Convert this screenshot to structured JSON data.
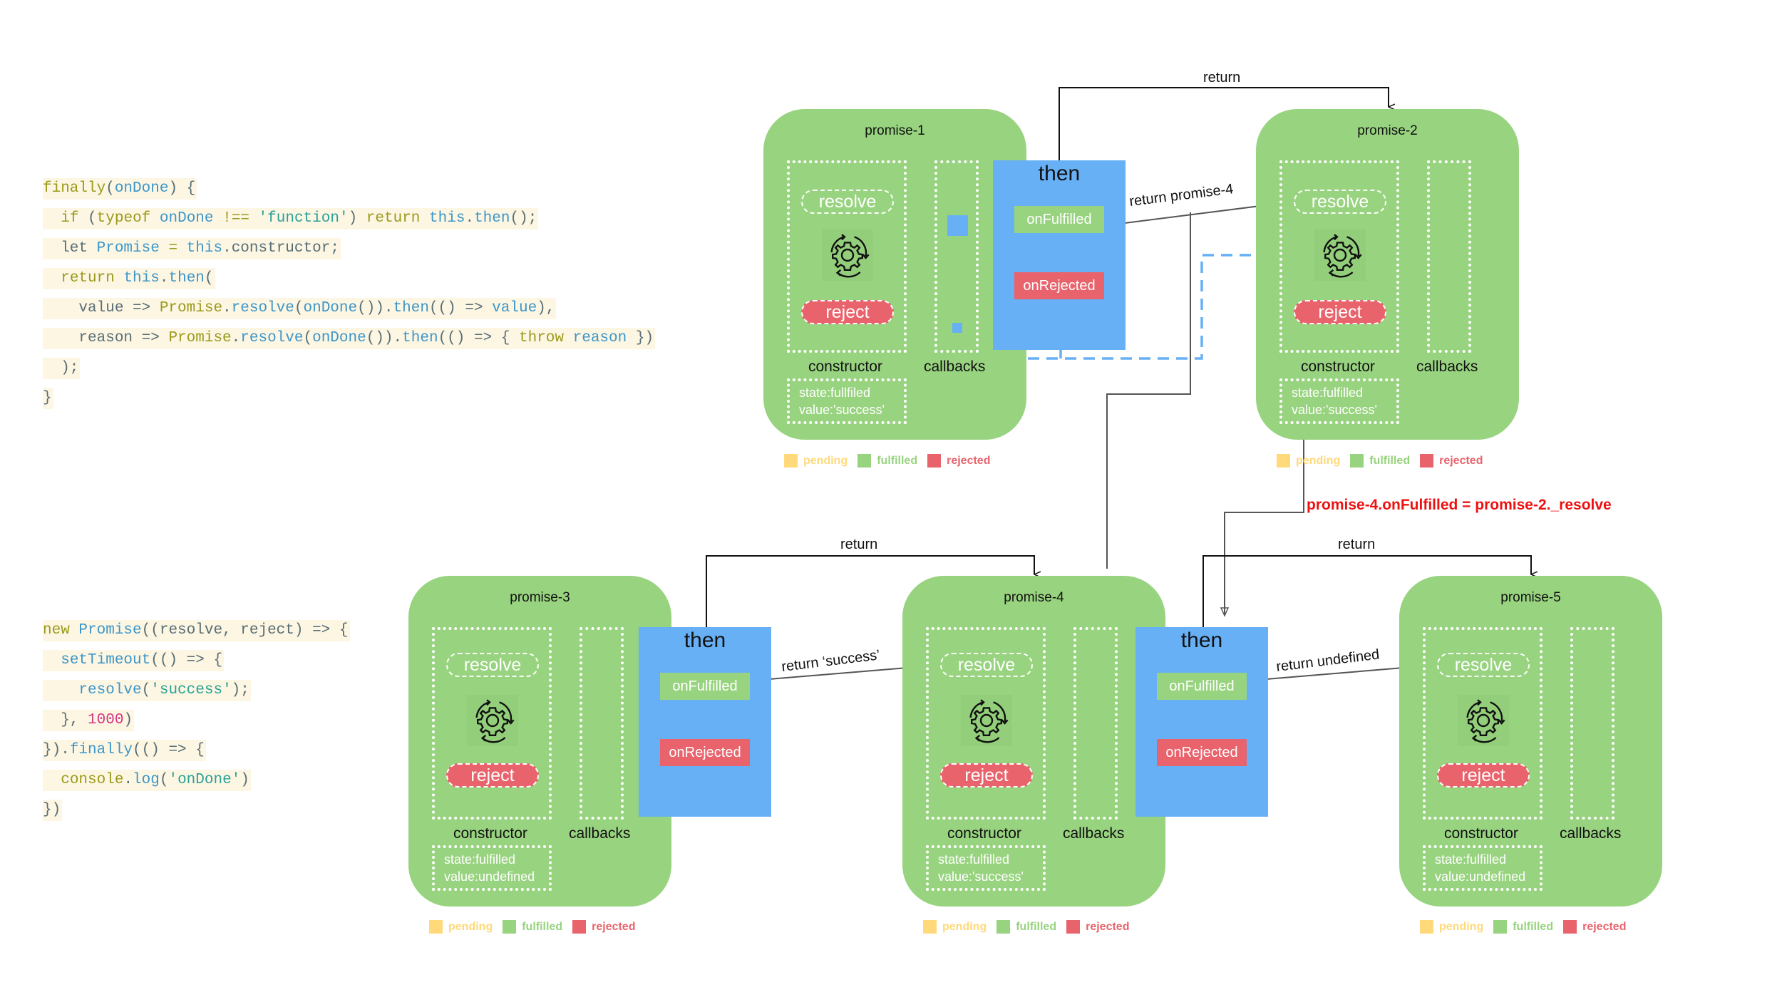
{
  "code_finally": {
    "lines": [
      [
        [
          "kw",
          "finally"
        ],
        [
          "plain",
          "("
        ],
        [
          "id",
          "onDone"
        ],
        [
          "plain",
          ") {"
        ]
      ],
      [
        [
          "plain",
          "  "
        ],
        [
          "kw",
          "if"
        ],
        [
          "plain",
          " ("
        ],
        [
          "kw",
          "typeof"
        ],
        [
          "plain",
          " "
        ],
        [
          "id",
          "onDone"
        ],
        [
          "plain",
          " "
        ],
        [
          "kw",
          "!=="
        ],
        [
          "plain",
          " "
        ],
        [
          "str",
          "'function'"
        ],
        [
          "plain",
          ") "
        ],
        [
          "kw",
          "return"
        ],
        [
          "plain",
          " "
        ],
        [
          "id",
          "this"
        ],
        [
          "plain",
          "."
        ],
        [
          "id",
          "then"
        ],
        [
          "plain",
          "();"
        ]
      ],
      [
        [
          "plain",
          "  let "
        ],
        [
          "id",
          "Promise"
        ],
        [
          "plain",
          " "
        ],
        [
          "kw",
          "="
        ],
        [
          "plain",
          " "
        ],
        [
          "id",
          "this"
        ],
        [
          "plain",
          ".constructor;"
        ]
      ],
      [
        [
          "plain",
          "  "
        ],
        [
          "kw",
          "return"
        ],
        [
          "plain",
          " "
        ],
        [
          "id",
          "this"
        ],
        [
          "plain",
          "."
        ],
        [
          "id",
          "then"
        ],
        [
          "plain",
          "("
        ]
      ],
      [
        [
          "plain",
          "    value => "
        ],
        [
          "kw",
          "Promise"
        ],
        [
          "plain",
          "."
        ],
        [
          "id",
          "resolve"
        ],
        [
          "plain",
          "("
        ],
        [
          "id",
          "onDone"
        ],
        [
          "plain",
          "())."
        ],
        [
          "id",
          "then"
        ],
        [
          "plain",
          "(() => "
        ],
        [
          "id",
          "value"
        ],
        [
          "plain",
          "),"
        ]
      ],
      [
        [
          "plain",
          "    reason => "
        ],
        [
          "kw",
          "Promise"
        ],
        [
          "plain",
          "."
        ],
        [
          "id",
          "resolve"
        ],
        [
          "plain",
          "("
        ],
        [
          "id",
          "onDone"
        ],
        [
          "plain",
          "())."
        ],
        [
          "id",
          "then"
        ],
        [
          "plain",
          "(() => { "
        ],
        [
          "kw",
          "throw"
        ],
        [
          "plain",
          " "
        ],
        [
          "id",
          "reason"
        ],
        [
          "plain",
          " })"
        ]
      ],
      [
        [
          "plain",
          "  );"
        ]
      ],
      [
        [
          "plain",
          "}"
        ]
      ]
    ]
  },
  "code_usage": {
    "lines": [
      [
        [
          "kw",
          "new"
        ],
        [
          "plain",
          " "
        ],
        [
          "id",
          "Promise"
        ],
        [
          "plain",
          "((resolve, reject) => {"
        ]
      ],
      [
        [
          "plain",
          "  "
        ],
        [
          "id",
          "setTimeout"
        ],
        [
          "plain",
          "(() => {"
        ]
      ],
      [
        [
          "plain",
          "    "
        ],
        [
          "id",
          "resolve"
        ],
        [
          "plain",
          "("
        ],
        [
          "str",
          "'success'"
        ],
        [
          "plain",
          ");"
        ]
      ],
      [
        [
          "plain",
          "  }, "
        ],
        [
          "num",
          "1000"
        ],
        [
          "plain",
          ")"
        ]
      ],
      [
        [
          "plain",
          "})."
        ],
        [
          "id",
          "finally"
        ],
        [
          "plain",
          "(() => {"
        ]
      ],
      [
        [
          "plain",
          "  "
        ],
        [
          "kw",
          "console"
        ],
        [
          "plain",
          "."
        ],
        [
          "id",
          "log"
        ],
        [
          "plain",
          "("
        ],
        [
          "str",
          "'onDone'"
        ],
        [
          "plain",
          ")"
        ]
      ],
      [
        [
          "plain",
          "})"
        ]
      ]
    ]
  },
  "colors": {
    "fulfilled": "#98d37f",
    "rejected": "#e8636c",
    "pending": "#ffd97a",
    "then_block": "#67b0f6",
    "code_bg": "#fdf6e3",
    "note": "#ee1111"
  },
  "promises": [
    {
      "title": "promise-1",
      "resolve": "resolve",
      "reject": "reject",
      "constructor_label": "constructor",
      "callbacks_label": "callbacks",
      "state": "state:fullfiled",
      "value": "value:'success'"
    },
    {
      "title": "promise-2",
      "resolve": "resolve",
      "reject": "reject",
      "constructor_label": "constructor",
      "callbacks_label": "callbacks",
      "state": "state:fulfilled",
      "value": "value:'success'"
    },
    {
      "title": "promise-3",
      "resolve": "resolve",
      "reject": "reject",
      "constructor_label": "constructor",
      "callbacks_label": "callbacks",
      "state": "state:fulfilled",
      "value": "value:undefined"
    },
    {
      "title": "promise-4",
      "resolve": "resolve",
      "reject": "reject",
      "constructor_label": "constructor",
      "callbacks_label": "callbacks",
      "state": "state:fulfilled",
      "value": "value:'success'"
    },
    {
      "title": "promise-5",
      "resolve": "resolve",
      "reject": "reject",
      "constructor_label": "constructor",
      "callbacks_label": "callbacks",
      "state": "state:fulfilled",
      "value": "value:undefined"
    }
  ],
  "then_blocks": [
    {
      "title": "then",
      "on_fulfilled": "onFulfilled",
      "on_rejected": "onRejected"
    },
    {
      "title": "then",
      "on_fulfilled": "onFulfilled",
      "on_rejected": "onRejected"
    },
    {
      "title": "then",
      "on_fulfilled": "onFulfilled",
      "on_rejected": "onRejected"
    }
  ],
  "legend": {
    "pending": "pending",
    "fulfilled": "fulfilled",
    "rejected": "rejected"
  },
  "edges": {
    "return_p1_p2": "return",
    "return_promise_4": "return promise-4",
    "return_p3_p4": "return",
    "return_success": "return ‘success’",
    "return_p4_p5": "return",
    "return_undefined": "return undefined"
  },
  "note": "promise-4.onFulfilled = promise-2._resolve"
}
